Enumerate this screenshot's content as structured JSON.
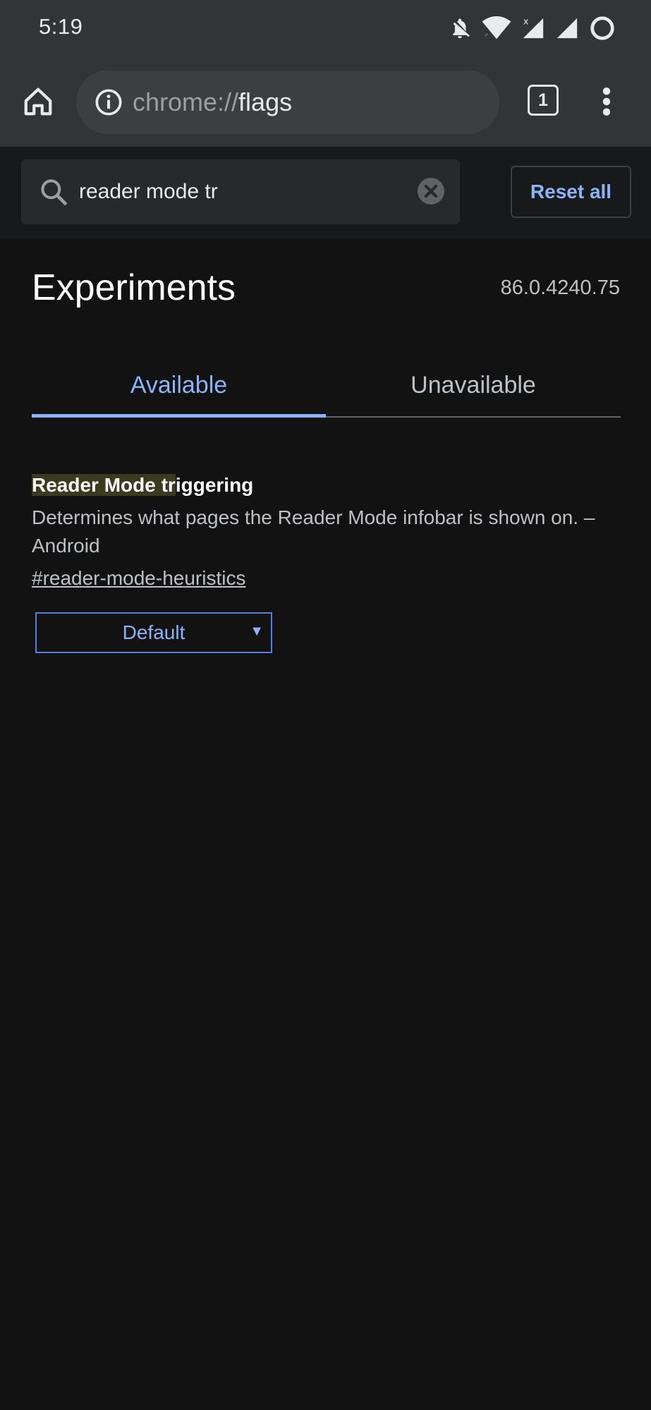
{
  "status_bar": {
    "time": "5:19",
    "icons": [
      "notifications-off-icon",
      "wifi-icon",
      "signal-icon",
      "signal-icon",
      "battery-icon"
    ]
  },
  "toolbar": {
    "url_scheme": "chrome://",
    "url_host": "flags",
    "tab_count": "1"
  },
  "search": {
    "value": "reader mode tr",
    "reset_label": "Reset all"
  },
  "main": {
    "title": "Experiments",
    "version": "86.0.4240.75",
    "tabs": [
      {
        "label": "Available"
      },
      {
        "label": "Unavailable"
      }
    ]
  },
  "experiments": [
    {
      "title_highlight": "Reader Mode tr",
      "title_rest": "iggering",
      "description": "Determines what pages the Reader Mode infobar is shown on. – Android",
      "link": "#reader-mode-heuristics",
      "selected": "Default"
    }
  ],
  "colors": {
    "accent": "#8ab4f8",
    "background": "#121212",
    "toolbar": "#323438"
  }
}
